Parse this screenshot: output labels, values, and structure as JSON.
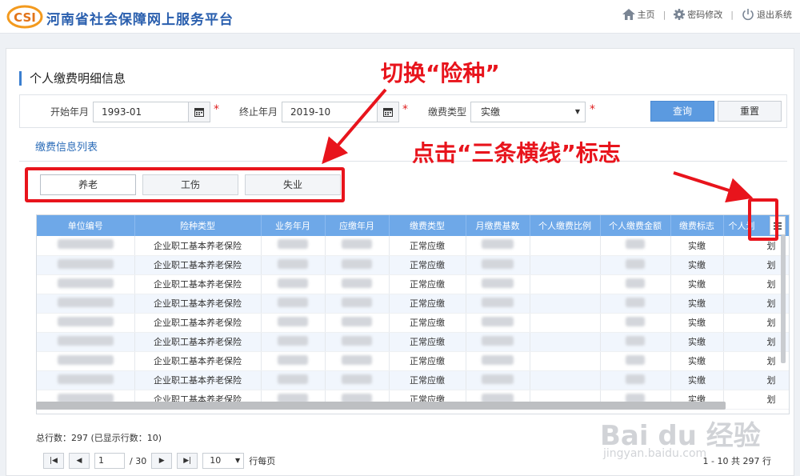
{
  "header": {
    "brand": "河南省社会保障网上服务平台",
    "logo_text": "CSI",
    "nav": [
      {
        "label": "主页",
        "icon": "home-icon"
      },
      {
        "label": "密码修改",
        "icon": "gear-icon"
      },
      {
        "label": "退出系统",
        "icon": "power-icon"
      }
    ]
  },
  "page": {
    "title": "个人缴费明细信息",
    "list_link": "缴费信息列表"
  },
  "filter": {
    "start_label": "开始年月",
    "start_value": "1993-01",
    "end_label": "终止年月",
    "end_value": "2019-10",
    "type_label": "缴费类型",
    "type_value": "实缴",
    "query_button": "查询",
    "reset_button": "重置",
    "required_mark": "*"
  },
  "tabs": [
    "养老",
    "工伤",
    "失业"
  ],
  "table": {
    "columns": [
      "单位编号",
      "险种类型",
      "业务年月",
      "应缴年月",
      "缴费类型",
      "月缴费基数",
      "个人缴费比例",
      "个人缴费金额",
      "缴费标志",
      "个人划"
    ],
    "rows": [
      {
        "insurance": "企业职工基本养老保险",
        "pay_type": "正常应缴",
        "flag": "实缴",
        "last": "划"
      },
      {
        "insurance": "企业职工基本养老保险",
        "pay_type": "正常应缴",
        "flag": "实缴",
        "last": "划"
      },
      {
        "insurance": "企业职工基本养老保险",
        "pay_type": "正常应缴",
        "flag": "实缴",
        "last": "划"
      },
      {
        "insurance": "企业职工基本养老保险",
        "pay_type": "正常应缴",
        "flag": "实缴",
        "last": "划"
      },
      {
        "insurance": "企业职工基本养老保险",
        "pay_type": "正常应缴",
        "flag": "实缴",
        "last": "划"
      },
      {
        "insurance": "企业职工基本养老保险",
        "pay_type": "正常应缴",
        "flag": "实缴",
        "last": "划"
      },
      {
        "insurance": "企业职工基本养老保险",
        "pay_type": "正常应缴",
        "flag": "实缴",
        "last": "划"
      },
      {
        "insurance": "企业职工基本养老保险",
        "pay_type": "正常应缴",
        "flag": "实缴",
        "last": "划"
      },
      {
        "insurance": "企业职工基本养老保险",
        "pay_type": "正常应缴",
        "flag": "实缴",
        "last": "划"
      }
    ]
  },
  "footer": {
    "total_text": "总行数：297 (已显示行数：10)",
    "page_value": "1",
    "page_total": "/ 30",
    "page_size": "10",
    "page_size_suffix": "行每页",
    "range_text": "1 - 10 共 297 行"
  },
  "annotations": {
    "switch_text": "切换“险种”",
    "menu_text": "点击“三条横线”标志"
  },
  "watermark": {
    "logo": "Bai du 经验",
    "url": "jingyan.baidu.com"
  },
  "colors": {
    "accent": "#6ea8e8",
    "annotation": "#e8141c",
    "brand": "#2a5fae"
  }
}
